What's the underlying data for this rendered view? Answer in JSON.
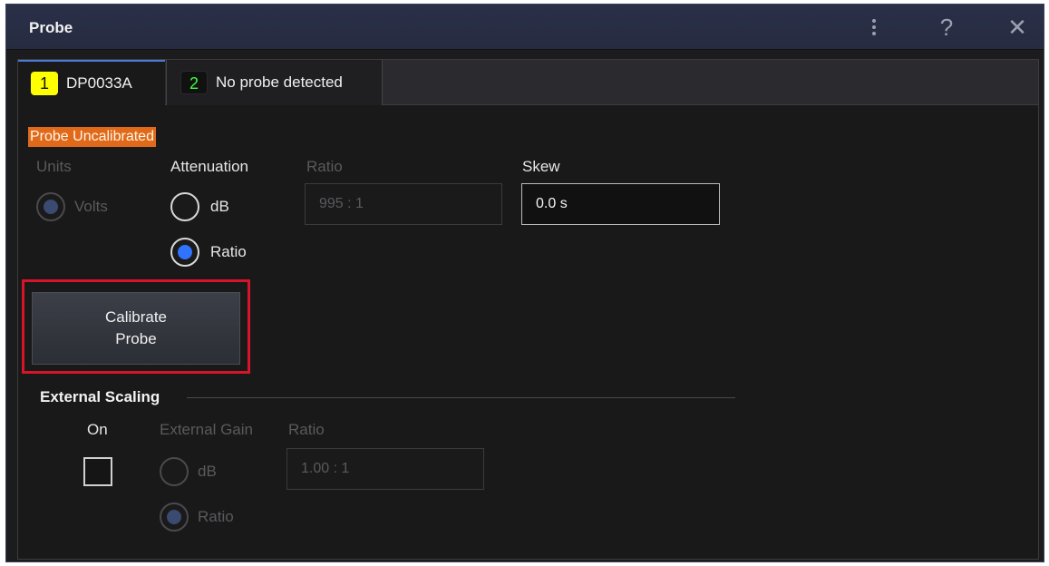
{
  "window": {
    "title": "Probe"
  },
  "titlebar": {
    "menu_icon": "kebab-menu-icon",
    "help_icon": "help-icon",
    "help_glyph": "?",
    "close_icon": "close-icon",
    "close_glyph": "✕"
  },
  "tabs": [
    {
      "number": "1",
      "label": "DP0033A",
      "badge_color": "#ffff00"
    },
    {
      "number": "2",
      "label": "No probe detected",
      "badge_color": "#39ff39"
    }
  ],
  "status": {
    "warning": "Probe Uncalibrated"
  },
  "probe": {
    "units_label": "Units",
    "units_option": "Volts",
    "attenuation_label": "Attenuation",
    "attenuation_options": [
      "dB",
      "Ratio"
    ],
    "attenuation_selected": "Ratio",
    "ratio_label": "Ratio",
    "ratio_value": "995 : 1",
    "skew_label": "Skew",
    "skew_value": "0.0 s"
  },
  "actions": {
    "calibrate_line1": "Calibrate",
    "calibrate_line2": "Probe"
  },
  "external_scaling": {
    "title": "External Scaling",
    "on_label": "On",
    "on_checked": false,
    "gain_label": "External Gain",
    "gain_options": [
      "dB",
      "Ratio"
    ],
    "gain_selected": "Ratio",
    "ratio_label": "Ratio",
    "ratio_value": "1.00 : 1"
  }
}
